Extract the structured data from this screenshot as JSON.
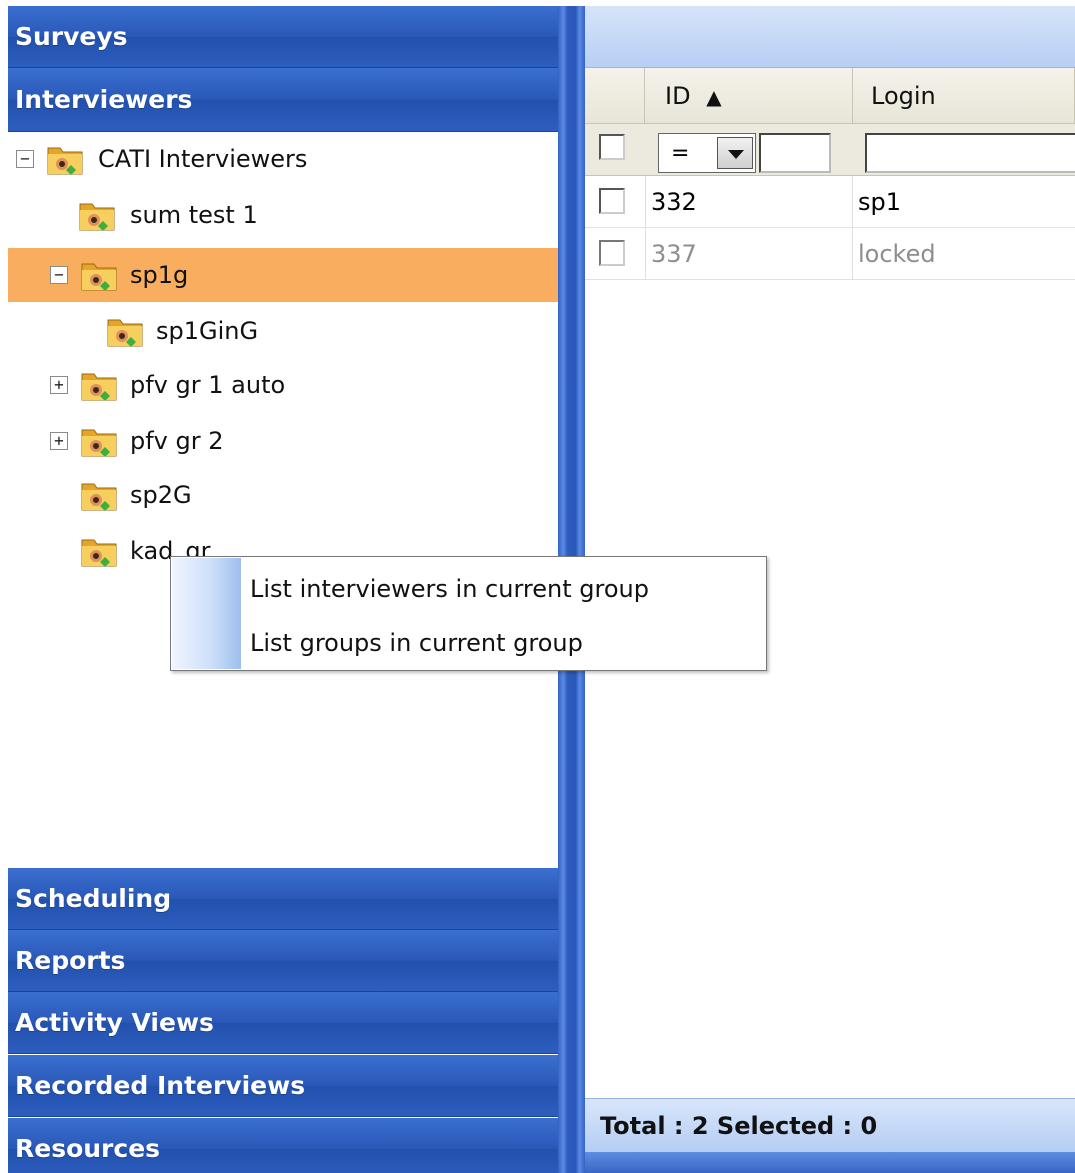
{
  "nav": {
    "top_sections": [
      "Surveys",
      "Interviewers"
    ],
    "bottom_sections": [
      "Scheduling",
      "Reports",
      "Activity Views",
      "Recorded Interviews",
      "Resources"
    ]
  },
  "tree": {
    "root": "CATI Interviewers",
    "items": [
      "sum test 1",
      "sp1g",
      "sp1GinG",
      "pfv gr 1 auto",
      "pfv gr 2",
      "sp2G",
      "kad_gr"
    ],
    "selected": "sp1g",
    "icons": [
      "interviewer-folder-icon"
    ],
    "selection_color": "#f9ad5f"
  },
  "context_menu": {
    "items": [
      "List interviewers in current group",
      "List groups in current group"
    ]
  },
  "grid": {
    "columns": [
      "ID",
      "Login"
    ],
    "sort_indicator": "▲",
    "filter": {
      "operator": "=",
      "value": "",
      "login_value": ""
    },
    "rows": [
      {
        "id": "332",
        "login": "sp1",
        "state": "normal"
      },
      {
        "id": "337",
        "login": "locked",
        "state": "locked"
      }
    ],
    "footer": "Total : 2 Selected : 0"
  },
  "colors": {
    "header_blue": "#2a58b8",
    "grid_header": "#e8e5d8",
    "footer": "#c3d7f6"
  }
}
